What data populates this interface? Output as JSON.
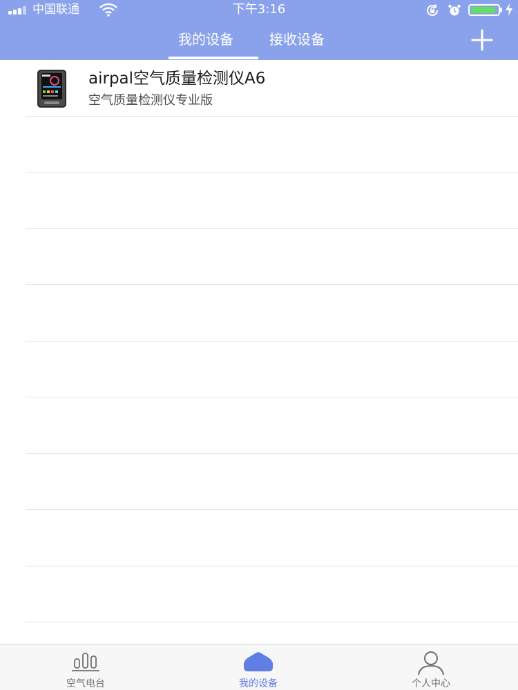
{
  "status_bar": {
    "carrier": "中国联通",
    "time": "下午3:16",
    "battery_level": 0.92,
    "battery_color": "#63e05f"
  },
  "nav": {
    "tabs": [
      {
        "label": "我的设备",
        "active": true
      },
      {
        "label": "接收设备",
        "active": false
      }
    ],
    "add_icon": "plus-icon"
  },
  "devices": [
    {
      "name": "airpal空气质量检测仪A6",
      "subtitle": "空气质量检测仪专业版",
      "thumb_icon": "air-quality-monitor-thumbnail"
    }
  ],
  "tabbar": {
    "items": [
      {
        "label": "空气电台",
        "icon": "bar-chart-icon",
        "active": false
      },
      {
        "label": "我的设备",
        "icon": "home-icon",
        "active": true
      },
      {
        "label": "个人中心",
        "icon": "person-icon",
        "active": false
      }
    ]
  },
  "colors": {
    "header_bg": "#8aa2ec",
    "accent": "#5f7fe5",
    "tab_inactive": "#6f6f6f"
  }
}
